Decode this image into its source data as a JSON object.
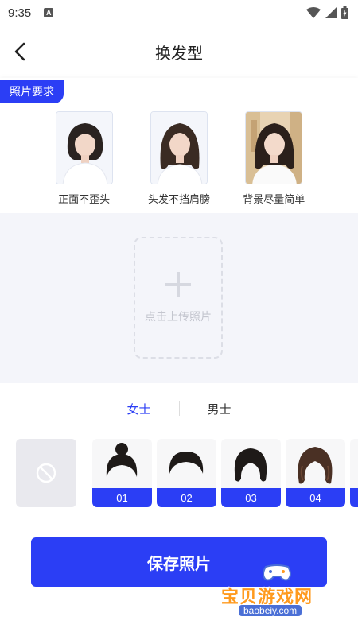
{
  "status": {
    "time": "9:35",
    "a_icon": "A",
    "icons": [
      "wifi-icon",
      "signal-icon",
      "battery-icon"
    ]
  },
  "header": {
    "title": "换发型",
    "back_icon": "chevron-left-icon"
  },
  "requirements": {
    "tag": "照片要求",
    "samples": [
      {
        "label": "正面不歪头"
      },
      {
        "label": "头发不挡肩膀"
      },
      {
        "label": "背景尽量简单"
      }
    ]
  },
  "upload": {
    "text": "点击上传照片",
    "icon": "plus-icon"
  },
  "gender_tabs": [
    {
      "label": "女士",
      "active": true
    },
    {
      "label": "男士",
      "active": false
    }
  ],
  "hairstyles": {
    "none_icon": "prohibited-icon",
    "items": [
      {
        "num": "01"
      },
      {
        "num": "02"
      },
      {
        "num": "03"
      },
      {
        "num": "04"
      }
    ]
  },
  "save_button": {
    "label": "保存照片"
  },
  "watermark": {
    "title": "宝贝游戏网",
    "url": "baobeiy.com"
  },
  "colors": {
    "accent": "#2b3ef5",
    "upload_bg": "#f4f5fa"
  }
}
